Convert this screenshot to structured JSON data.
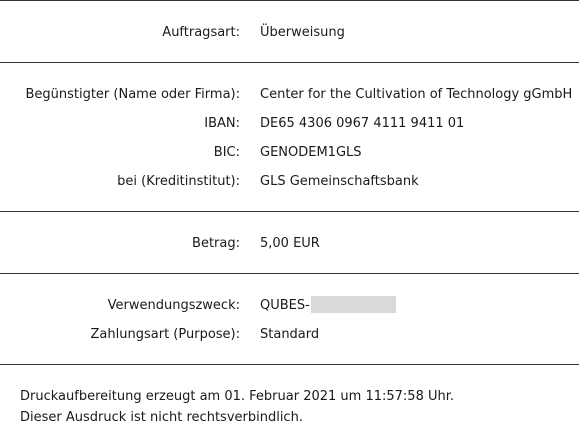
{
  "order": {
    "type_label": "Auftragsart:",
    "type_value": "Überweisung"
  },
  "beneficiary": {
    "name_label": "Begünstigter (Name oder Firma):",
    "name_value": "Center for the Cultivation of Technology gGmbH",
    "iban_label": "IBAN:",
    "iban_value": "DE65 4306 0967 4111 9411 01",
    "bic_label": "BIC:",
    "bic_value": "GENODEM1GLS",
    "bank_label": "bei (Kreditinstitut):",
    "bank_value": "GLS Gemeinschaftsbank"
  },
  "amount": {
    "label": "Betrag:",
    "value": "5,00 EUR"
  },
  "purpose": {
    "reference_label": "Verwendungszweck:",
    "reference_value": "QUBES-",
    "payment_type_label": "Zahlungsart (Purpose):",
    "payment_type_value": "Standard"
  },
  "footer": {
    "line1": "Druckaufbereitung erzeugt am 01. Februar 2021 um 11:57:58 Uhr.",
    "line2": "Dieser Ausdruck ist nicht rechtsverbindlich."
  },
  "colors": {
    "divider": "#333333",
    "redaction": "#d9d9d9"
  }
}
